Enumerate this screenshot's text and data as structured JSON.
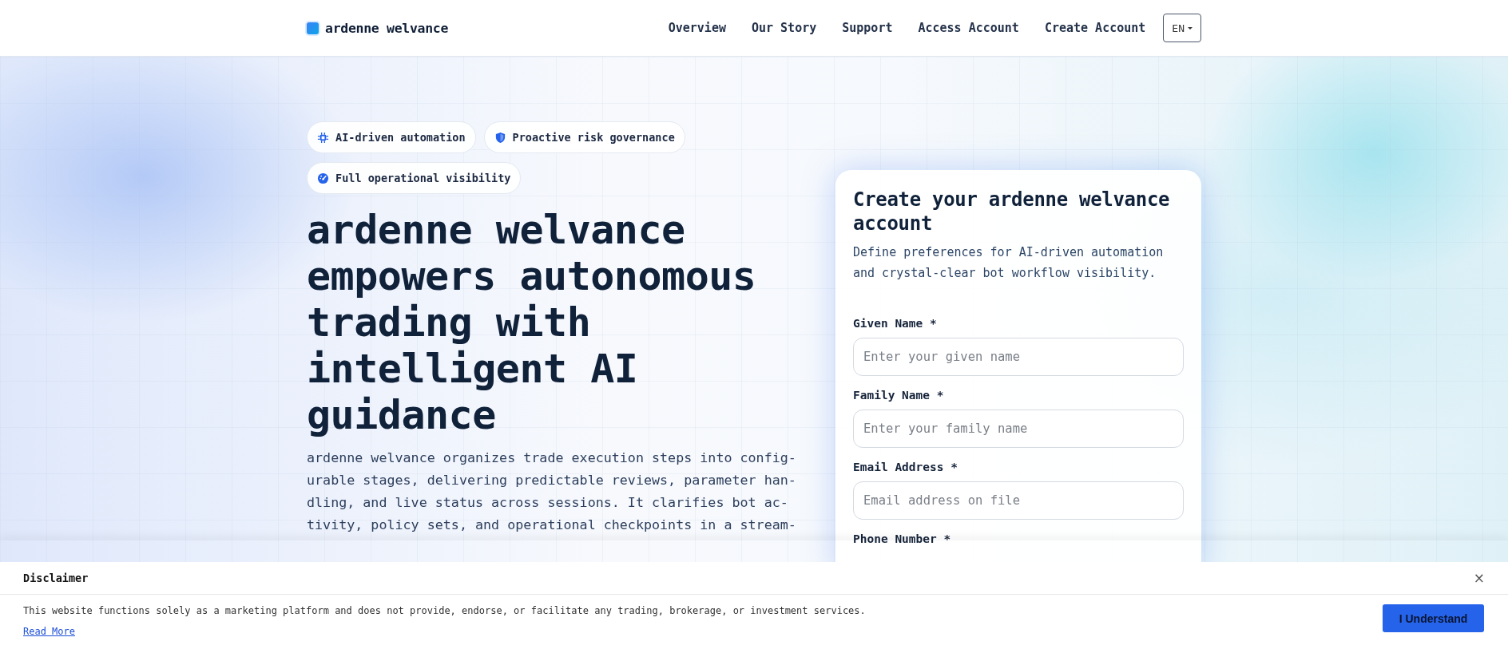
{
  "header": {
    "logo": "ardenne welvance",
    "nav": [
      {
        "label": "Overview"
      },
      {
        "label": "Our Story"
      },
      {
        "label": "Support"
      },
      {
        "label": "Access Account"
      },
      {
        "label": "Create Account"
      }
    ],
    "language": "EN"
  },
  "hero": {
    "chips": [
      {
        "label": "AI-driven automation"
      },
      {
        "label": "Proactive risk governance"
      },
      {
        "label": "Full operational visibility"
      }
    ],
    "heading": "ardenne welvance empowers autonomous trading with intelligent AI guidance",
    "paragraph_lines": [
      "ardenne welvance organizes trade execution steps into config-",
      "urable stages, delivering predictable reviews, parameter han-",
      "dling, and live status across sessions. It clarifies bot ac-",
      "tivity, policy sets, and operational checkpoints in a stream-"
    ]
  },
  "signup": {
    "title": "Create your ardenne welvance account",
    "subtitle": "Define preferences for AI-driven automation and crystal-clear bot workflow visibility.",
    "fields": [
      {
        "label": "Given Name *",
        "placeholder": "Enter your given name"
      },
      {
        "label": "Family Name *",
        "placeholder": "Enter your family name"
      },
      {
        "label": "Email Address *",
        "placeholder": "Email address on file"
      },
      {
        "label": "Phone Number *"
      }
    ]
  },
  "disclaimer": {
    "title": "Disclaimer",
    "close": "×",
    "text": "This website functions solely as a marketing platform and does not provide, endorse, or facilitate any trading, brokerage, or investment services.",
    "link": "Read More",
    "button": "I Understand"
  }
}
